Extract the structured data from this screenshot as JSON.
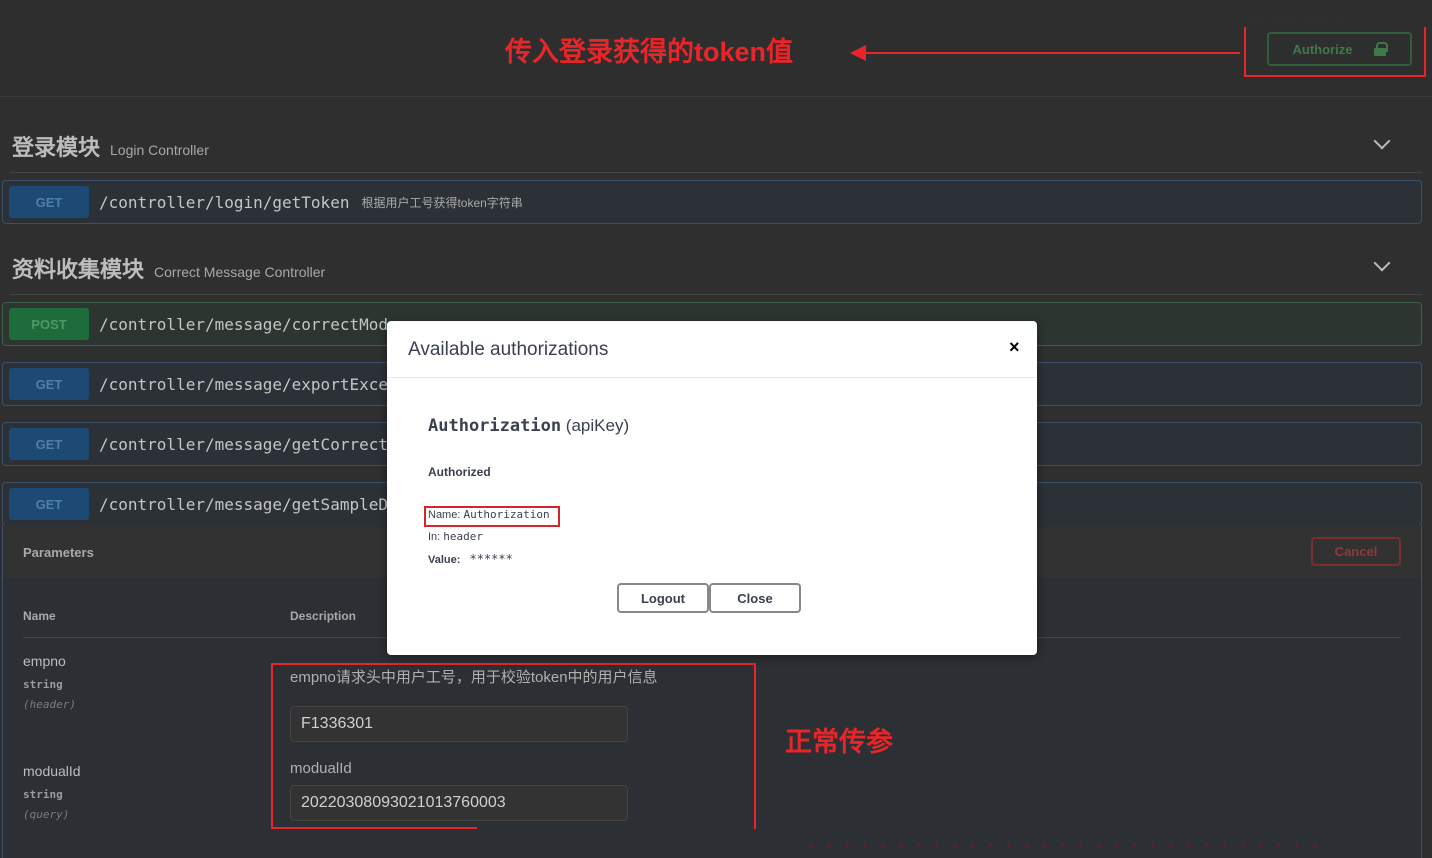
{
  "topbar": {
    "authorize_label": "Authorize"
  },
  "annotations": {
    "token_note": "传入登录获得的token值",
    "normal_note": "正常传参"
  },
  "sections": [
    {
      "title": "登录模块",
      "subtitle": "Login Controller",
      "operations": [
        {
          "method": "GET",
          "path": "/controller/login/getToken",
          "summary": "根据用户工号获得token字符串"
        }
      ]
    },
    {
      "title": "资料收集模块",
      "subtitle": "Correct Message Controller",
      "operations": [
        {
          "method": "POST",
          "path": "/controller/message/correctMod",
          "summary": ""
        },
        {
          "method": "GET",
          "path": "/controller/message/exportExce",
          "summary": ""
        },
        {
          "method": "GET",
          "path": "/controller/message/getCorrect",
          "summary": ""
        },
        {
          "method": "GET",
          "path": "/controller/message/getSampleD",
          "summary": ""
        }
      ]
    }
  ],
  "parameters": {
    "title": "Parameters",
    "cancel_label": "Cancel",
    "col_name": "Name",
    "col_description": "Description",
    "rows": [
      {
        "name": "empno",
        "type": "string",
        "in": "(header)",
        "description": "empno请求头中用户工号，用于校验token中的用户信息",
        "value": "F1336301"
      },
      {
        "name": "modualId",
        "type": "string",
        "in": "(query)",
        "description": "modualId",
        "value": "20220308093021013760003"
      }
    ]
  },
  "modal": {
    "title": "Available authorizations",
    "close_glyph": "×",
    "auth_code": "Authorization",
    "auth_type": "(apiKey)",
    "status": "Authorized",
    "name_label": "Name:",
    "name_value": "Authorization",
    "in_label": "In:",
    "in_value": "header",
    "value_label": "Value:",
    "value_value": "******",
    "logout_label": "Logout",
    "close_label": "Close"
  },
  "colors": {
    "annotation_red": "#e8262a",
    "get_blue": "#1c4a75",
    "post_green": "#1e6b3c"
  }
}
